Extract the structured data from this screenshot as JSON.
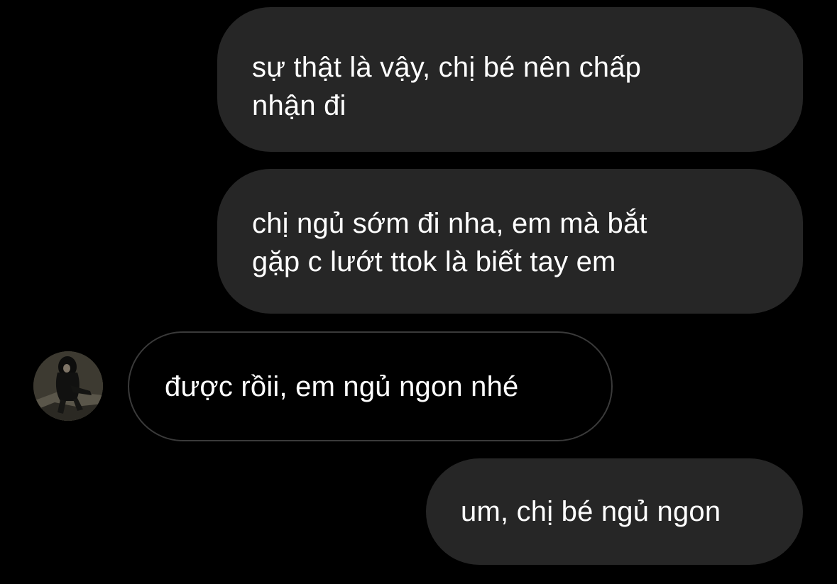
{
  "chat": {
    "messages": [
      {
        "direction": "outgoing",
        "text": "sự thật là vậy, chị bé nên chấp\nnhận đi"
      },
      {
        "direction": "outgoing",
        "text": "chị ngủ sớm đi nha, em mà bắt\ngặp c lướt ttok là biết tay em"
      },
      {
        "direction": "incoming",
        "text": "được rồii, em ngủ ngon nhé"
      },
      {
        "direction": "outgoing",
        "text": "um, chị bé ngủ ngon"
      }
    ]
  },
  "colors": {
    "background": "#000000",
    "outgoing_bubble": "#262626",
    "incoming_border": "#3a3a3a",
    "text": "#ffffff"
  },
  "icons": {
    "avatar": "contact-avatar-photo"
  }
}
